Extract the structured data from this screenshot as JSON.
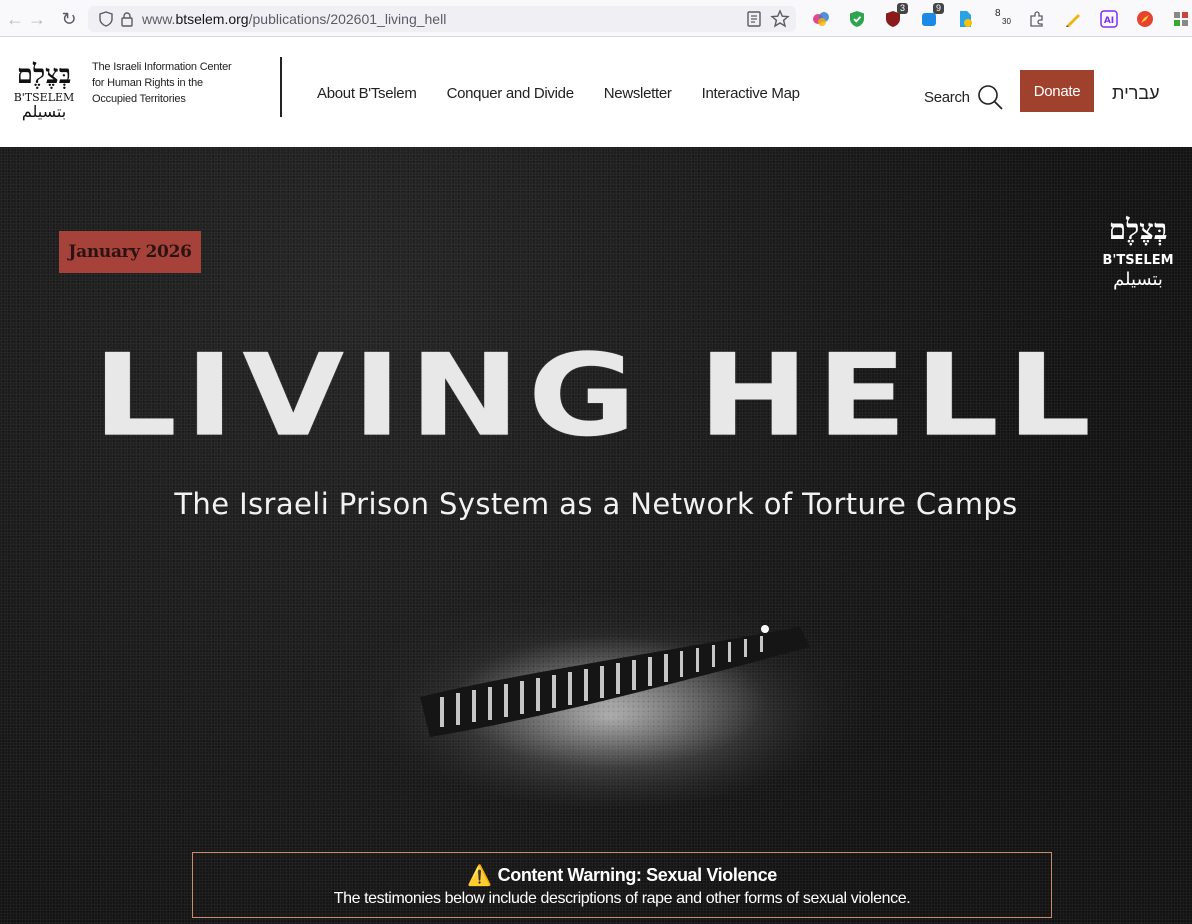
{
  "browser": {
    "url_prefix": "www.",
    "url_host": "btselem.org",
    "url_path": "/publications/202601_living_hell",
    "extension_badges": [
      "3",
      "9"
    ],
    "extension_counter_top": "8",
    "extension_counter_bottom": "30"
  },
  "header": {
    "logo_hebrew": "בְּצֶלֶם",
    "logo_latin": "B'TSELEM",
    "logo_arabic": "بتسيلم",
    "tagline": [
      "The Israeli Information Center",
      "for Human Rights in the",
      "Occupied Territories"
    ],
    "nav": [
      "About B'Tselem",
      "Conquer and Divide",
      "Newsletter",
      "Interactive Map"
    ],
    "search_label": "Search",
    "donate_label": "Donate",
    "language_label": "עברית"
  },
  "hero": {
    "date_badge": "January 2026",
    "title": "LIVING HELL",
    "subtitle": "The Israeli Prison System as a Network of Torture Camps",
    "warning_title": "Content Warning: Sexual Violence",
    "warning_text": "The testimonies below include descriptions of rape and other forms of sexual violence.",
    "warning_icon": "⚠️"
  },
  "colors": {
    "brand_red": "#a0412d",
    "date_badge_bg": "#a6423a",
    "hero_bg": "#1a1a1a",
    "warning_border": "#c98a6e"
  }
}
